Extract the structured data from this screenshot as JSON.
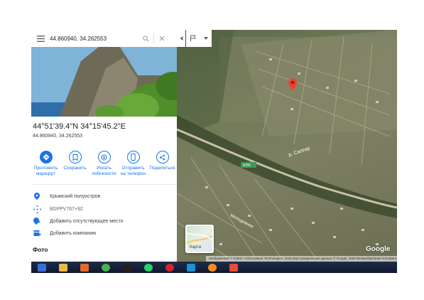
{
  "search": {
    "value": "44.860940, 34.262553"
  },
  "place": {
    "title": "44°51'39.4\"N 34°15'45.2\"E",
    "coords": "44.860940, 34.262553"
  },
  "actions": [
    {
      "label": "Проложить маршрут",
      "icon": "directions-icon"
    },
    {
      "label": "Сохранить",
      "icon": "bookmark-icon"
    },
    {
      "label": "Искать поблизости",
      "icon": "nearby-icon"
    },
    {
      "label": "Отправить на телефон",
      "icon": "phone-icon"
    },
    {
      "label": "Поделиться",
      "icon": "share-icon"
    }
  ],
  "info": {
    "region": "Крымский полуостров",
    "pluscode": "8GPPV767+92",
    "add_place": "Добавить отсутствующее место",
    "add_business": "Добавить компанию"
  },
  "photos_heading": "Фото",
  "map": {
    "road_label": "р. Салгир",
    "road_number": "6/56",
    "street_label": "Молодежная",
    "layer_thumb_label": "Карта",
    "logo": "Google",
    "attribution": "Изображения © CNES / Airbus,Maxar Technologies, 2020,Картографические данные © Google, 2020  Великобритания  Условия использования  Оставить отзыв  20 м",
    "pin_color": "#ea4335"
  },
  "taskbar": [
    {
      "name": "start-icon",
      "color": "#3a6fd0"
    },
    {
      "name": "file-explorer-icon",
      "color": "#e8b84a"
    },
    {
      "name": "media-player-icon",
      "color": "#e36a2b"
    },
    {
      "name": "chrome-icon",
      "color": "#4caf50"
    },
    {
      "name": "terminal-icon",
      "color": "#222222"
    },
    {
      "name": "whatsapp-icon",
      "color": "#25d366"
    },
    {
      "name": "opera-icon",
      "color": "#d3242a"
    },
    {
      "name": "ie-icon",
      "color": "#1e90d8"
    },
    {
      "name": "firefox-icon",
      "color": "#ff8c1a"
    },
    {
      "name": "app-icon",
      "color": "#e74c3c"
    }
  ]
}
